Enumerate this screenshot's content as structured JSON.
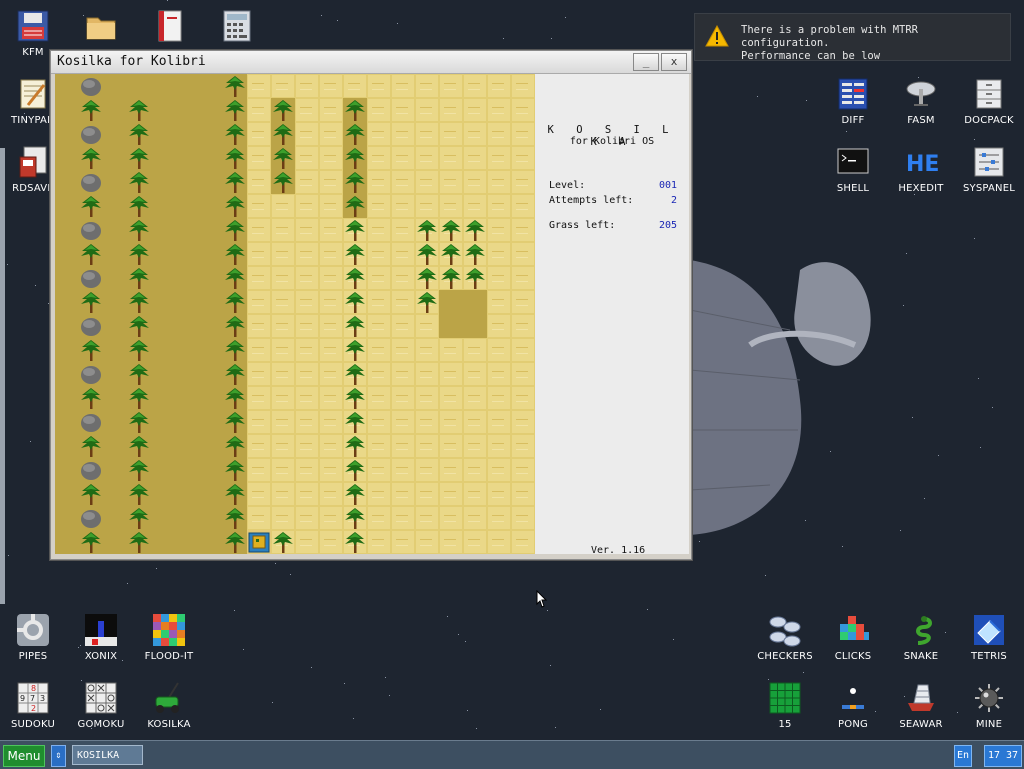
{
  "desktop": {
    "icons_left": [
      {
        "label": "KFM",
        "icon": "floppy-disk-icon"
      },
      {
        "label": "",
        "icon": "folder-icon"
      },
      {
        "label": "",
        "icon": "red-notebook-icon"
      },
      {
        "label": "",
        "icon": "calculator-icon"
      },
      {
        "label": "TINYPAD",
        "icon": "notepad-icon"
      },
      {
        "label": "RDSAVE",
        "icon": "ramdisk-save-icon"
      }
    ],
    "icons_right": [
      {
        "label": "DIFF",
        "icon": "diff-icon"
      },
      {
        "label": "FASM",
        "icon": "fasm-icon"
      },
      {
        "label": "DOCPACK",
        "icon": "docpack-icon"
      },
      {
        "label": "SHELL",
        "icon": "shell-icon"
      },
      {
        "label": "HEXEDIT",
        "icon": "hexedit-icon"
      },
      {
        "label": "SYSPANEL",
        "icon": "syspanel-icon"
      }
    ],
    "icons_bottom_left": [
      {
        "label": "PIPES",
        "icon": "pipes-icon"
      },
      {
        "label": "XONIX",
        "icon": "xonix-icon"
      },
      {
        "label": "FLOOD-IT",
        "icon": "flood-it-icon"
      },
      {
        "label": "SUDOKU",
        "icon": "sudoku-icon"
      },
      {
        "label": "GOMOKU",
        "icon": "gomoku-icon"
      },
      {
        "label": "KOSILKA",
        "icon": "lawnmower-icon"
      }
    ],
    "icons_bottom_right": [
      {
        "label": "CHECKERS",
        "icon": "checkers-icon"
      },
      {
        "label": "CLICKS",
        "icon": "clicks-icon"
      },
      {
        "label": "SNAKE",
        "icon": "snake-icon"
      },
      {
        "label": "TETRIS",
        "icon": "tetris-icon"
      },
      {
        "label": "15",
        "icon": "fifteen-puzzle-icon"
      },
      {
        "label": "PONG",
        "icon": "pong-icon"
      },
      {
        "label": "SEAWAR",
        "icon": "seawar-icon"
      },
      {
        "label": "MINE",
        "icon": "mine-icon"
      }
    ]
  },
  "notification": {
    "line1": "There is a problem with MTRR configuration.",
    "line2": "Performance can be low"
  },
  "window": {
    "title": "Kosilka for Kolibri",
    "minimize_label": "_",
    "close_label": "x"
  },
  "panel": {
    "heading": "K O S I L K A",
    "subheading": "for Kolibri OS",
    "level_label": "Level:",
    "level_value": "001",
    "attempts_label": "Attempts left:",
    "attempts_value": "2",
    "grass_label": "Grass left:",
    "grass_value": "205",
    "version": "Ver. 1.16"
  },
  "taskbar": {
    "menu_label": "Menu",
    "switch_label": "⇕",
    "task_label": "KOSILKA",
    "lang": "En",
    "clock": "17 37"
  },
  "colors": {
    "desktop_bg": "#1e2530",
    "mowed": "#bba447",
    "grass": "#ead888",
    "taskbar": "#3d4f61",
    "menu_green": "#1f8d2e"
  }
}
